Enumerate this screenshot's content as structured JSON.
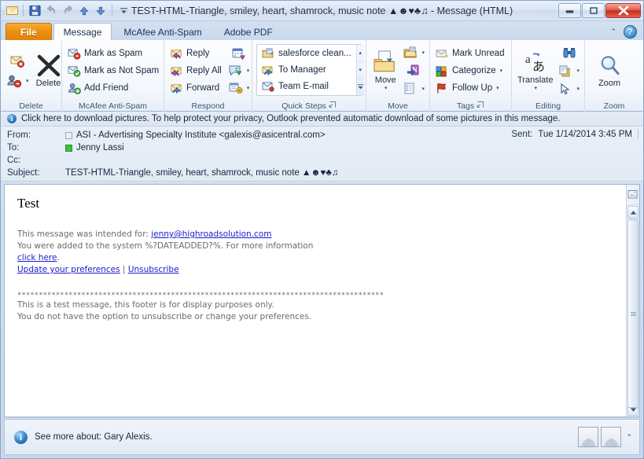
{
  "window": {
    "title": "TEST-HTML-Triangle, smiley, heart, shamrock, music note ▲☻♥♣♫ - Message (HTML)",
    "minimize_label": "—",
    "restore_label": "❐",
    "close_label": "✕"
  },
  "quick_access": {
    "items": [
      {
        "name": "envelope-icon",
        "tooltip": "Message"
      },
      {
        "name": "save-icon",
        "tooltip": "Save"
      },
      {
        "name": "undo-icon",
        "tooltip": "Undo"
      },
      {
        "name": "redo-icon",
        "tooltip": "Redo"
      },
      {
        "name": "previous-item-icon",
        "tooltip": "Previous Item"
      },
      {
        "name": "next-item-icon",
        "tooltip": "Next Item"
      },
      {
        "name": "customize-qat-icon",
        "tooltip": "Customize Quick Access Toolbar"
      }
    ]
  },
  "tabs": [
    {
      "label": "File",
      "type": "file"
    },
    {
      "label": "Message",
      "type": "active"
    },
    {
      "label": "McAfee Anti-Spam",
      "type": "normal"
    },
    {
      "label": "Adobe PDF",
      "type": "normal"
    }
  ],
  "tab_right": {
    "collapse_label": "⌃",
    "help_label": "?"
  },
  "ribbon": {
    "groups": [
      {
        "name": "delete",
        "label": "Delete",
        "small_buttons": [
          {
            "label": "",
            "icon": "ignore-icon"
          },
          {
            "label": "",
            "icon": "junk-icon",
            "caret": "▾"
          }
        ],
        "big_button": {
          "label": "Delete",
          "icon": "delete-x-icon"
        }
      },
      {
        "name": "mcafee-anti-spam",
        "label": "McAfee Anti-Spam",
        "items": [
          {
            "label": "Mark as Spam",
            "icon": "mark-spam-icon"
          },
          {
            "label": "Mark as Not Spam",
            "icon": "mark-not-spam-icon"
          },
          {
            "label": "Add Friend",
            "icon": "add-friend-icon"
          }
        ]
      },
      {
        "name": "respond",
        "label": "Respond",
        "items": [
          {
            "label": "Reply",
            "icon": "reply-icon"
          },
          {
            "label": "Reply All",
            "icon": "reply-all-icon"
          },
          {
            "label": "Forward",
            "icon": "forward-icon"
          }
        ],
        "extra_icons": [
          {
            "label": "",
            "icon": "meeting-icon"
          },
          {
            "label": "",
            "icon": "im-icon",
            "caret": "▾"
          },
          {
            "label": "",
            "icon": "more-respond-icon",
            "caret": "▾"
          }
        ]
      },
      {
        "name": "quick-steps",
        "label": "Quick Steps",
        "items": [
          {
            "label": "salesforce clean...",
            "icon": "quickstep-salesforce-icon"
          },
          {
            "label": "To Manager",
            "icon": "quickstep-to-manager-icon"
          },
          {
            "label": "Team E-mail",
            "icon": "quickstep-team-email-icon"
          }
        ],
        "scroll": [
          "▴",
          "▾",
          "▾"
        ],
        "has_launcher": true
      },
      {
        "name": "move",
        "label": "Move",
        "big_button": {
          "label": "Move",
          "icon": "move-folder-icon",
          "caret": "▾"
        },
        "small_buttons": [
          {
            "label": "",
            "icon": "rules-icon",
            "caret": "▾"
          },
          {
            "label": "",
            "icon": "onenote-icon"
          },
          {
            "label": "",
            "icon": "actions-icon",
            "caret": "▾"
          }
        ]
      },
      {
        "name": "tags",
        "label": "Tags",
        "items": [
          {
            "label": "Mark Unread",
            "icon": "mark-unread-icon"
          },
          {
            "label": "Categorize",
            "icon": "categorize-icon",
            "caret": "▾"
          },
          {
            "label": "Follow Up",
            "icon": "follow-up-flag-icon",
            "caret": "▾"
          }
        ],
        "has_launcher": true
      },
      {
        "name": "editing",
        "label": "Editing",
        "big_button": {
          "label": "Translate",
          "icon": "translate-icon",
          "caret": "▾"
        },
        "small_buttons": [
          {
            "label": "",
            "icon": "find-binoculars-icon"
          },
          {
            "label": "",
            "icon": "related-items-icon",
            "caret": "▾"
          },
          {
            "label": "",
            "icon": "select-pointer-icon",
            "caret": "▾"
          }
        ]
      },
      {
        "name": "zoom",
        "label": "Zoom",
        "big_button": {
          "label": "Zoom",
          "icon": "zoom-magnifier-icon"
        }
      }
    ]
  },
  "info_bar": {
    "icon": "info-icon",
    "text": "Click here to download pictures. To help protect your privacy, Outlook prevented automatic download of some pictures in this message."
  },
  "header": {
    "from_label": "From:",
    "from_value": "ASI - Advertising Specialty Institute <galexis@asicentral.com>",
    "to_label": "To:",
    "to_value": "Jenny Lassi",
    "cc_label": "Cc:",
    "cc_value": "",
    "subject_label": "Subject:",
    "subject_value": "TEST-HTML-Triangle, smiley, heart, shamrock, music note ▲☻♥♣♫",
    "sent_label": "Sent:",
    "sent_value": "Tue 1/14/2014 3:45 PM"
  },
  "body": {
    "heading": "Test",
    "line1_prefix": "This message was intended for: ",
    "line1_link": "jenny@highroadsolution.com",
    "line2": "You were added to the system %?DATEADDED?%. For more information",
    "line3_link": "click here",
    "line3_suffix": ".",
    "line4_link1": "Update your preferences",
    "line4_sep": " | ",
    "line4_link2": "Unsubscribe",
    "separator": "**************************************************************************************",
    "footer1": "This is a test message, this footer is for display purposes only.",
    "footer2": "You do not have the option to unsubscribe or change your preferences.",
    "blocked_image_icon": "blocked-image-placeholder-icon"
  },
  "scrollbar": {
    "up_label": "▲",
    "down_label": "▼"
  },
  "status": {
    "icon": "info-icon",
    "text": "See more about: Gary Alexis.",
    "collapse_label": "⌃",
    "avatars": [
      "contact-photo-1",
      "contact-photo-2"
    ]
  },
  "colors": {
    "file_tab": "#ec8f0c",
    "close_button": "#c32e1c",
    "link": "#1a1ad0",
    "presence_online": "#3fbf3f",
    "info_blue": "#2b7fc4"
  }
}
